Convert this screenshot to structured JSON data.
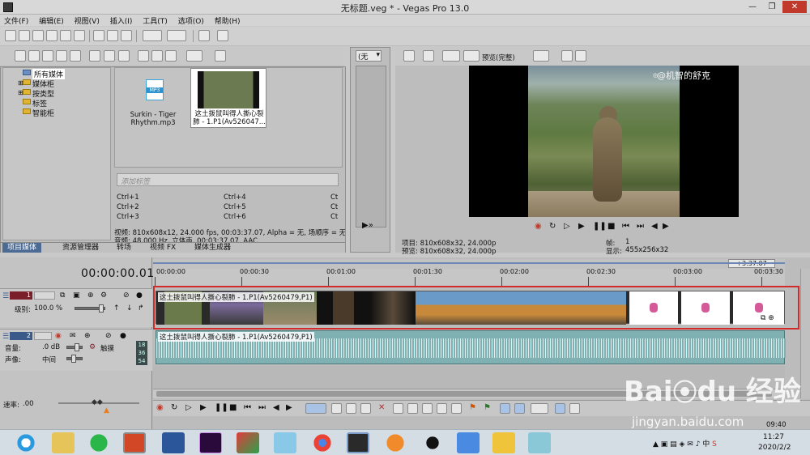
{
  "window": {
    "title": "无标题.veg * - Vegas Pro 13.0"
  },
  "menu": [
    "文件(F)",
    "编辑(E)",
    "视图(V)",
    "插入(I)",
    "工具(T)",
    "选项(O)",
    "帮助(H)"
  ],
  "explorer": {
    "tree": [
      "所有媒体",
      "媒体柜",
      "按类型",
      "标签",
      "智能柜"
    ],
    "files": [
      {
        "name": "Surkin - Tiger Rhythm.mp3",
        "badge": "MP3"
      },
      {
        "name": "这土拨鼠叫得人撕心裂肺 - 1.P1(Av526047..."
      }
    ],
    "tag_placeholder": "添加标签",
    "shortcuts": [
      "Ctrl+1",
      "Ctrl+4",
      "Ct",
      "Ctrl+2",
      "Ctrl+5",
      "Ct",
      "Ctrl+3",
      "Ctrl+6",
      "Ct"
    ],
    "info_line1": "视频: 810x608x12, 24.000 fps, 00:03:37.07, Alpha = 无, 场顺序 = 无",
    "info_line2": "音频: 48,000 Hz, 立体声, 00:03:37.07, AAC",
    "tabs": [
      "项目媒体",
      "资源管理器",
      "转场",
      "视频 FX",
      "媒体生成器"
    ]
  },
  "trimmer": {
    "dropdown": "(无"
  },
  "preview": {
    "mode": "预览(完整)",
    "watermark": "@机智的舒克",
    "project_label": "项目:",
    "project_value": "810x608x32, 24.000p",
    "preview_label": "预览:",
    "preview_value": "810x608x32, 24.000p",
    "frame_label": "帧:",
    "frame_value": "1",
    "display_label": "显示:",
    "display_value": "455x256x32"
  },
  "timeline": {
    "timecode": "00:00:00.01",
    "end_marker": "+3:37.07",
    "ruler": [
      "00:00:00",
      "00:00:30",
      "00:01:00",
      "00:01:30",
      "00:02:00",
      "00:02:30",
      "00:03:00",
      "00:03:30"
    ],
    "video_clip": "这土拨鼠叫得人撕心裂肺 - 1.P1(Av5260479,P1)",
    "audio_clip": "这土拨鼠叫得人撕心裂肺 - 1.P1(Av5260479,P1)",
    "track1": {
      "number": "1",
      "level_label": "级别:",
      "level_value": "100.0 %"
    },
    "track2": {
      "number": "2",
      "volume_label": "音量:",
      "volume_value": ".0 dB",
      "pan_label": "声像:",
      "pan_value": "中间",
      "mode": "触摸",
      "meters": [
        "18",
        "36",
        "54"
      ]
    },
    "rate_label": "速率:",
    "rate_value": ".00",
    "bottom_time": "09:40"
  },
  "watermark_site": "jingyan.baidu.com",
  "taskbar": {
    "time": "11:27",
    "date": "2020/2/2"
  }
}
